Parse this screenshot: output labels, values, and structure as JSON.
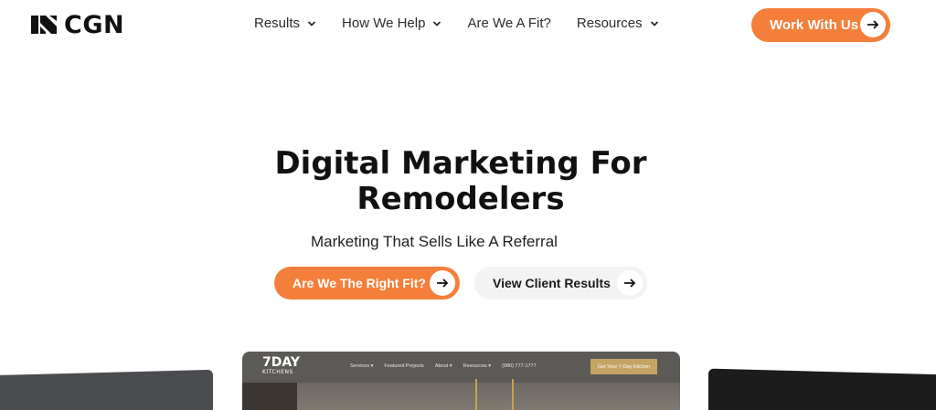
{
  "header": {
    "logo_text": "CGN",
    "nav": [
      {
        "label": "Results",
        "has_dropdown": true
      },
      {
        "label": "How We Help",
        "has_dropdown": true
      },
      {
        "label": "Are We A Fit?",
        "has_dropdown": false
      },
      {
        "label": "Resources",
        "has_dropdown": true
      }
    ],
    "cta_label": "Work With Us"
  },
  "hero": {
    "title_line1": "Digital Marketing For",
    "title_line2": "Remodelers",
    "subtitle": "Marketing That Sells Like A Referral",
    "primary_button": "Are We The Right Fit?",
    "secondary_button": "View Client Results"
  },
  "preview": {
    "logo_main": "7DAY",
    "logo_sub": "KITCHENS",
    "nav": [
      "Services ▾",
      "Featured Projects",
      "About ▾",
      "Resources ▾",
      "(980) 777-1777"
    ],
    "cta": "Get Your 7-Day Kitchen"
  },
  "colors": {
    "accent": "#f47f3b",
    "secondary_button_bg": "#f3f3f3",
    "text_dark": "#111111"
  }
}
